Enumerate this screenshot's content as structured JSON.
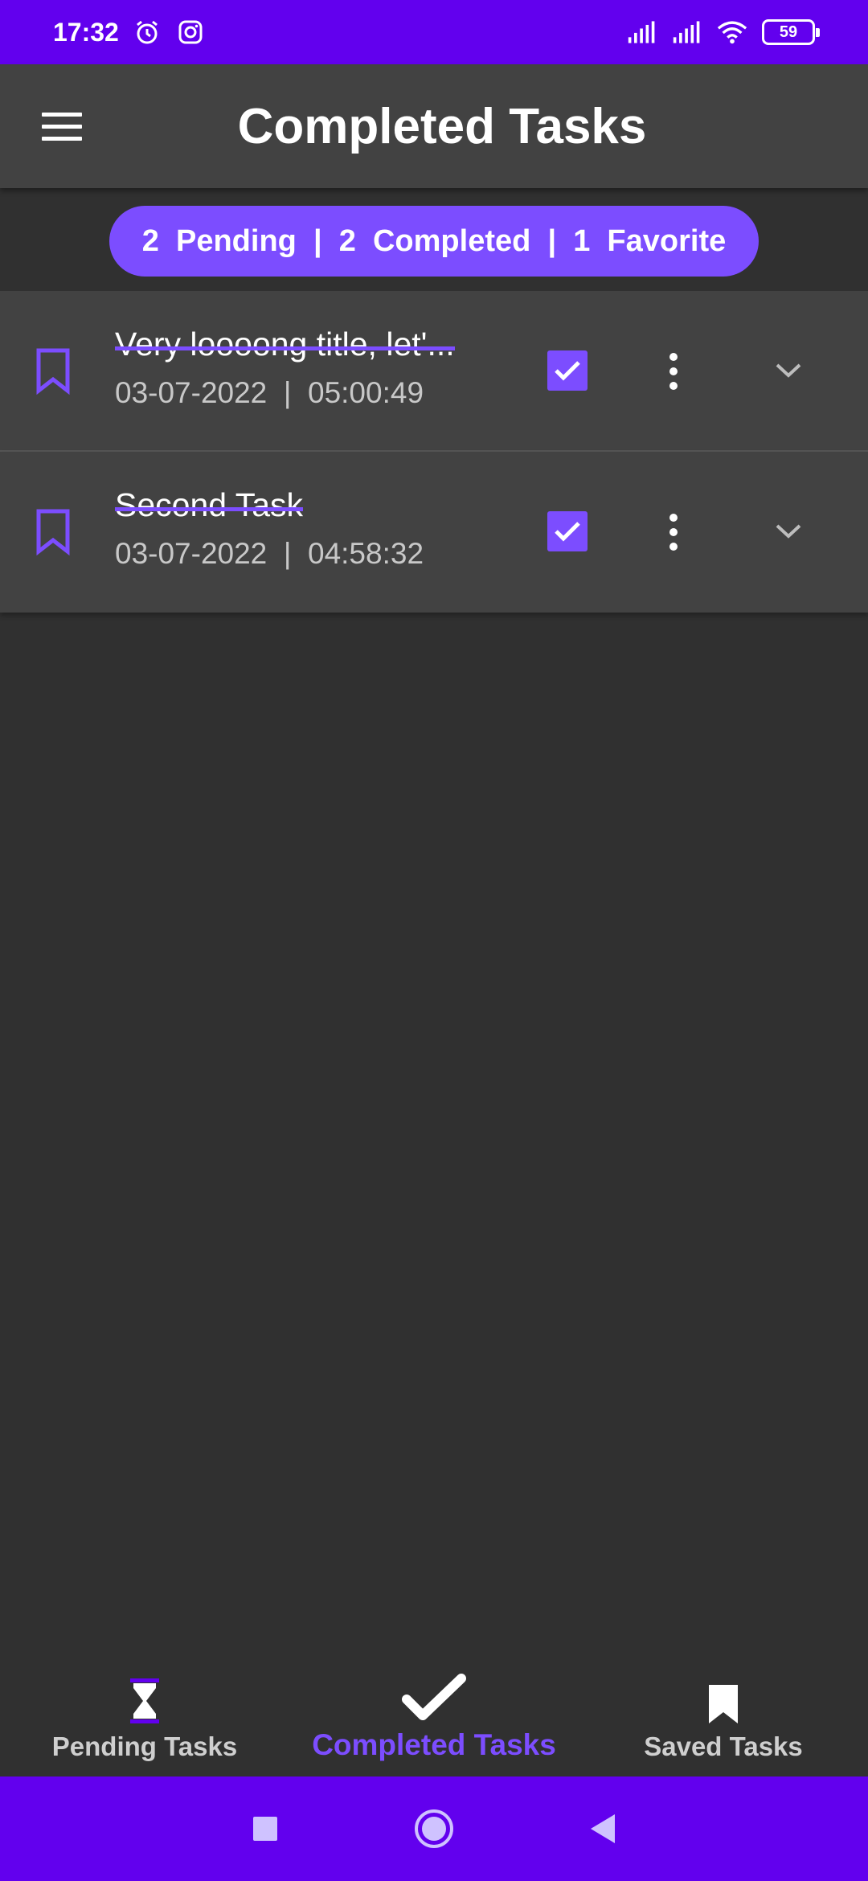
{
  "status_bar": {
    "time": "17:32",
    "battery": "59",
    "icons": [
      "alarm-icon",
      "instagram-icon",
      "signal-icon",
      "signal-icon",
      "wifi-icon",
      "battery-icon"
    ]
  },
  "app_bar": {
    "title": "Completed Tasks",
    "menu_icon": "menu-icon"
  },
  "summary": {
    "text": "2  Pending  |  2  Completed  |  1  Favorite"
  },
  "tasks": [
    {
      "title": "Very loooong title, let'...",
      "date": "03-07-2022  |  05:00:49",
      "completed": true,
      "bookmark_icon": "bookmark-outline-icon"
    },
    {
      "title": "Second Task",
      "date": "03-07-2022  |  04:58:32",
      "completed": true,
      "bookmark_icon": "bookmark-outline-icon"
    }
  ],
  "bottom_nav": {
    "items": [
      {
        "label": "Pending Tasks",
        "icon": "hourglass-icon",
        "active": false
      },
      {
        "label": "Completed Tasks",
        "icon": "checkmark-icon",
        "active": true
      },
      {
        "label": "Saved Tasks",
        "icon": "bookmark-icon",
        "active": false
      }
    ]
  },
  "colors": {
    "accent": "#7C4DFF",
    "status_bar": "#6200EE",
    "surface": "#424242",
    "background": "#303030"
  }
}
